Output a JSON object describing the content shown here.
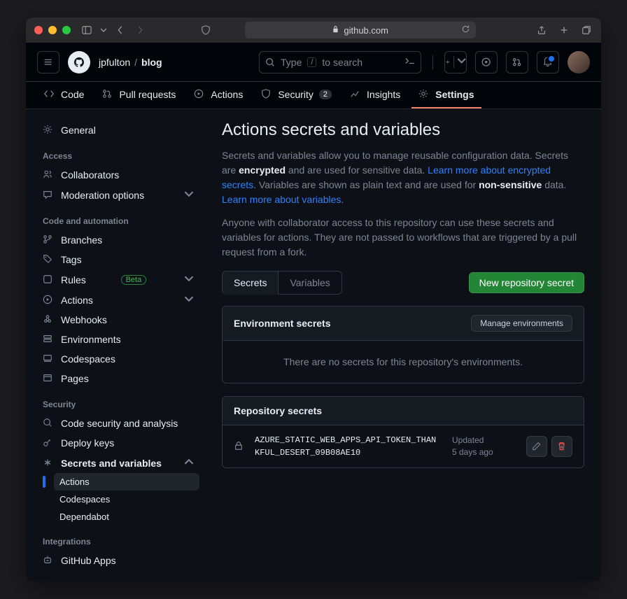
{
  "browser": {
    "url": "github.com"
  },
  "breadcrumb": {
    "owner": "jpfulton",
    "repo": "blog"
  },
  "search": {
    "placeholder": "to search",
    "prefix": "Type",
    "slash": "/"
  },
  "repo_tabs": {
    "code": "Code",
    "pulls": "Pull requests",
    "actions": "Actions",
    "security": "Security",
    "security_count": "2",
    "insights": "Insights",
    "settings": "Settings"
  },
  "sidebar": {
    "general": "General",
    "heading_access": "Access",
    "collaborators": "Collaborators",
    "moderation": "Moderation options",
    "heading_code": "Code and automation",
    "branches": "Branches",
    "tags": "Tags",
    "rules": "Rules",
    "rules_badge": "Beta",
    "actions": "Actions",
    "webhooks": "Webhooks",
    "environments": "Environments",
    "codespaces": "Codespaces",
    "pages": "Pages",
    "heading_security": "Security",
    "code_security": "Code security and analysis",
    "deploy_keys": "Deploy keys",
    "secrets_vars": "Secrets and variables",
    "sub_actions": "Actions",
    "sub_codespaces": "Codespaces",
    "sub_dependabot": "Dependabot",
    "heading_integrations": "Integrations",
    "github_apps": "GitHub Apps"
  },
  "page": {
    "title": "Actions secrets and variables",
    "desc_1": "Secrets and variables allow you to manage reusable configuration data. Secrets are ",
    "desc_encrypted": "encrypted",
    "desc_2": " and are used for sensitive data. ",
    "link_secrets": "Learn more about encrypted secrets",
    "desc_3": ". Variables are shown as plain text and are used for ",
    "desc_nonsens": "non-sensitive",
    "desc_4": " data. ",
    "link_vars": "Learn more about variables",
    "desc_5": ".",
    "desc_para2": "Anyone with collaborator access to this repository can use these secrets and variables for actions. They are not passed to workflows that are triggered by a pull request from a fork.",
    "tab_secrets": "Secrets",
    "tab_variables": "Variables",
    "btn_new": "New repository secret",
    "env_secrets_title": "Environment secrets",
    "btn_manage_env": "Manage environments",
    "env_empty": "There are no secrets for this repository's environments.",
    "repo_secrets_title": "Repository secrets",
    "secret_name": "AZURE_STATIC_WEB_APPS_API_TOKEN_THANKFUL_DESERT_09B08AE10",
    "secret_updated_label": "Updated",
    "secret_updated_val": "5 days ago"
  }
}
